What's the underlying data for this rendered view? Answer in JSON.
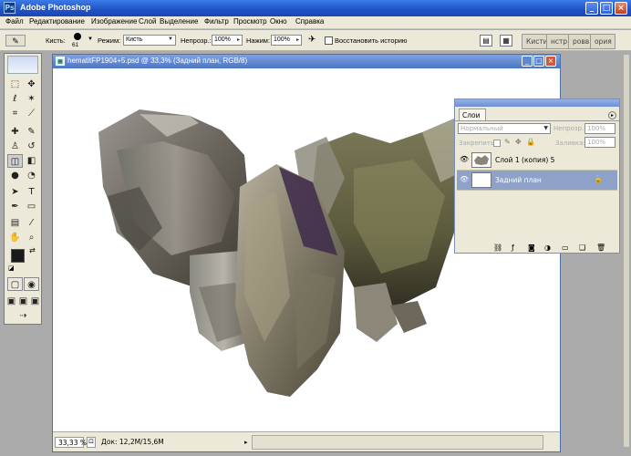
{
  "app": {
    "title": "Adobe Photoshop",
    "icon": "photoshop-icon"
  },
  "window_controls": {
    "minimize": "_",
    "maximize": "□",
    "close": "×"
  },
  "menu": [
    "Файл",
    "Редактирование",
    "Изображение",
    "Слой",
    "Выделение",
    "Фильтр",
    "Просмотр",
    "Окно",
    "Справка"
  ],
  "options": {
    "brush_label": "Кисть:",
    "brush_size": "61",
    "mode_label": "Режим:",
    "mode_value": "Кисть",
    "opacity_label": "Непрозр.:",
    "opacity_value": "100%",
    "pressure_label": "Нажим:",
    "pressure_value": "100%",
    "restore_history": "Восстановить историю",
    "tabs": [
      "Кисти",
      "нстр",
      "ровв",
      "ория"
    ]
  },
  "document": {
    "title": "hematitFP1904+5.psd @ 33,3% (Задний план, RGB/8)",
    "zoom": "33,33 %",
    "doc_size": "Док: 12,2M/15,6M"
  },
  "layers_panel": {
    "tab": "Слои",
    "blend_mode": "Нормальный",
    "opacity_label": "Непрозр.:",
    "opacity_value": "100%",
    "lock_label": "Закрепить:",
    "fill_label": "Заливка:",
    "fill_value": "100%",
    "layers": [
      {
        "name": "Слой 1 (копия) 5",
        "selected": false
      },
      {
        "name": "Задний план",
        "selected": true
      }
    ]
  },
  "colors": {
    "title_bar": "#1e52c7",
    "chrome": "#ece9d8",
    "workspace": "#ababab",
    "selected_layer": "#8ea2c9"
  }
}
